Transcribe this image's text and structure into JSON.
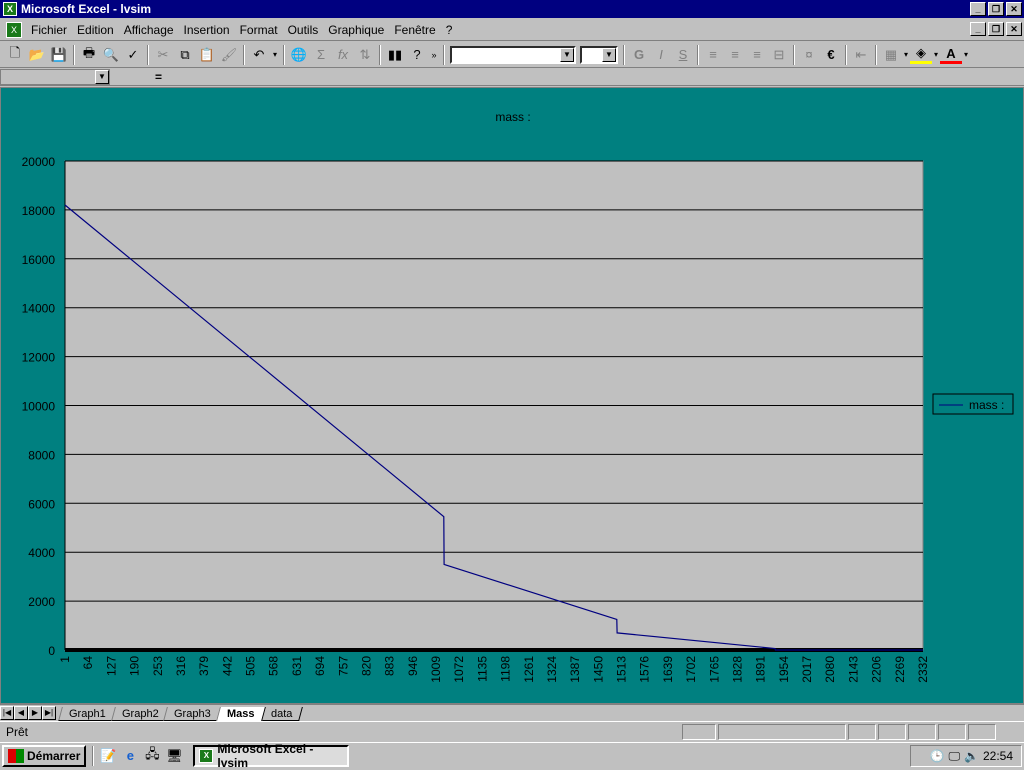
{
  "window": {
    "title": "Microsoft Excel - lvsim",
    "app_icon": "excel-icon"
  },
  "menu": {
    "items": [
      {
        "label": "Fichier",
        "accel": "F"
      },
      {
        "label": "Edition",
        "accel": "E"
      },
      {
        "label": "Affichage",
        "accel": "A"
      },
      {
        "label": "Insertion",
        "accel": "I"
      },
      {
        "label": "Format",
        "accel": "o"
      },
      {
        "label": "Outils",
        "accel": "O"
      },
      {
        "label": "Graphique",
        "accel": "G"
      },
      {
        "label": "Fenêtre",
        "accel": "n"
      },
      {
        "label": "?",
        "accel": "?"
      }
    ]
  },
  "toolbar": {
    "font_name": "",
    "font_size": "",
    "bold_label": "G",
    "italic_label": "I",
    "underline_label": "S",
    "euro_label": "€"
  },
  "formula_bar": {
    "name_box": "",
    "equals": "=",
    "content": ""
  },
  "chart_data": {
    "type": "line",
    "title": "mass :",
    "xlabel": "",
    "ylabel": "",
    "ylim": [
      0,
      20000
    ],
    "yticks": [
      0,
      2000,
      4000,
      6000,
      8000,
      10000,
      12000,
      14000,
      16000,
      18000,
      20000
    ],
    "x_tick_labels": [
      "1",
      "64",
      "127",
      "190",
      "253",
      "316",
      "379",
      "442",
      "505",
      "568",
      "631",
      "694",
      "757",
      "820",
      "883",
      "946",
      "1009",
      "1072",
      "1135",
      "1198",
      "1261",
      "1324",
      "1387",
      "1450",
      "1513",
      "1576",
      "1639",
      "1702",
      "1765",
      "1828",
      "1891",
      "1954",
      "2017",
      "2080",
      "2143",
      "2206",
      "2269",
      "2332"
    ],
    "xlim": [
      1,
      2332
    ],
    "grid": true,
    "legend_position": "right",
    "colors": {
      "plot_bg": "#c0c0c0",
      "chart_bg": "#008080",
      "series": "#000080",
      "grid": "#000000"
    },
    "series": [
      {
        "name": "mass :",
        "points": [
          {
            "x": 1,
            "y": 18200
          },
          {
            "x": 1030,
            "y": 5450
          },
          {
            "x": 1031,
            "y": 3500
          },
          {
            "x": 1500,
            "y": 1250
          },
          {
            "x": 1501,
            "y": 700
          },
          {
            "x": 1930,
            "y": 60
          },
          {
            "x": 1931,
            "y": 0
          },
          {
            "x": 2332,
            "y": 0
          }
        ]
      }
    ]
  },
  "sheet_tabs": {
    "tabs": [
      "Graph1",
      "Graph2",
      "Graph3",
      "Mass",
      "data"
    ],
    "active": "Mass"
  },
  "status": {
    "text": "Prêt"
  },
  "taskbar": {
    "start_label": "Démarrer",
    "task_label": "Microsoft Excel - lvsim",
    "clock": "22:54"
  }
}
